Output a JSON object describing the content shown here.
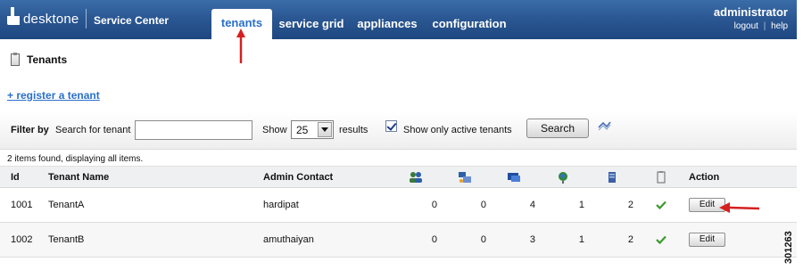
{
  "header": {
    "brand": "desktone",
    "app_name": "Service Center",
    "tabs": [
      {
        "label": "tenants",
        "active": true
      },
      {
        "label": "service grid",
        "active": false
      },
      {
        "label": "appliances",
        "active": false
      },
      {
        "label": "configuration",
        "active": false
      }
    ],
    "user": {
      "name": "administrator",
      "logout": "logout",
      "separator": "|",
      "help": "help"
    }
  },
  "page": {
    "title": "Tenants",
    "register_link": "+ register a tenant"
  },
  "filter": {
    "label": "Filter by",
    "search_label": "Search for tenant",
    "search_value": "",
    "show_label": "Show",
    "page_size": "25",
    "results_label": "results",
    "active_only_checked": true,
    "active_only_label": "Show only active tenants",
    "search_button": "Search"
  },
  "items_found": "2 items found, displaying all items.",
  "table": {
    "headers": {
      "id": "Id",
      "name": "Tenant Name",
      "contact": "Admin Contact",
      "action": "Action"
    },
    "icon_columns": [
      "users-icon",
      "desktops-icon",
      "monitors-icon",
      "globe-icon",
      "server-icon",
      "clipboard-icon"
    ],
    "rows": [
      {
        "id": "1001",
        "name": "TenantA",
        "contact": "hardipat",
        "c1": "0",
        "c2": "0",
        "c3": "4",
        "c4": "1",
        "c5": "2",
        "active": true,
        "action": "Edit"
      },
      {
        "id": "1002",
        "name": "TenantB",
        "contact": "amuthaiyan",
        "c1": "0",
        "c2": "0",
        "c3": "3",
        "c4": "1",
        "c5": "2",
        "active": true,
        "action": "Edit"
      }
    ]
  },
  "figure_id": "301263",
  "colors": {
    "header_blue": "#2b5893",
    "link_blue": "#2a70c8",
    "callout_red": "#d42020",
    "check_green": "#3a9a2a"
  }
}
